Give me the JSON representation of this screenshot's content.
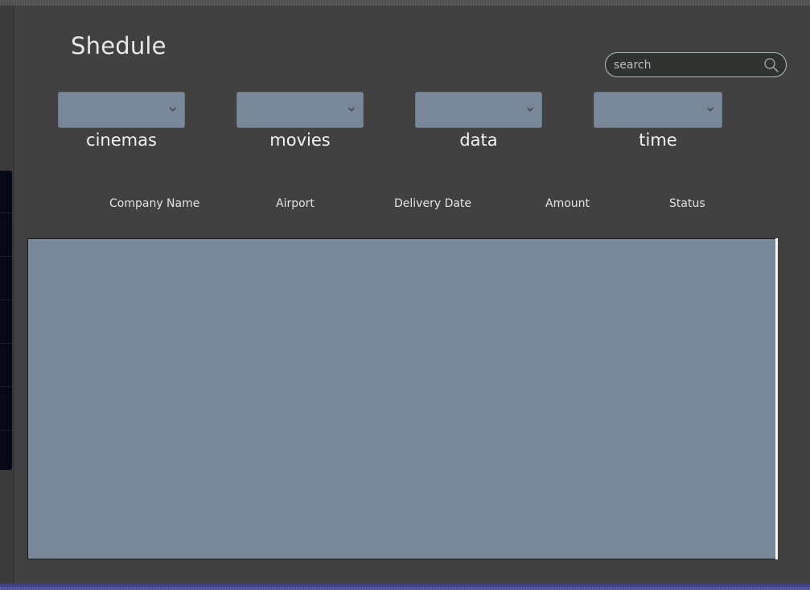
{
  "page": {
    "title": "Shedule"
  },
  "search": {
    "placeholder": "search",
    "value": "",
    "icon": "search-icon"
  },
  "filters": [
    {
      "label": "cinemas",
      "selected": ""
    },
    {
      "label": "movies",
      "selected": ""
    },
    {
      "label": "data",
      "selected": ""
    },
    {
      "label": "time",
      "selected": ""
    }
  ],
  "table": {
    "columns": [
      "Company Name",
      "Airport",
      "Delivery Date",
      "Amount",
      "Status"
    ],
    "rows": []
  },
  "colors": {
    "background": "#414141",
    "control": "#788899",
    "text": "#e8e8e8",
    "search_bg": "#2e3330",
    "search_border": "#b8bcc0"
  }
}
